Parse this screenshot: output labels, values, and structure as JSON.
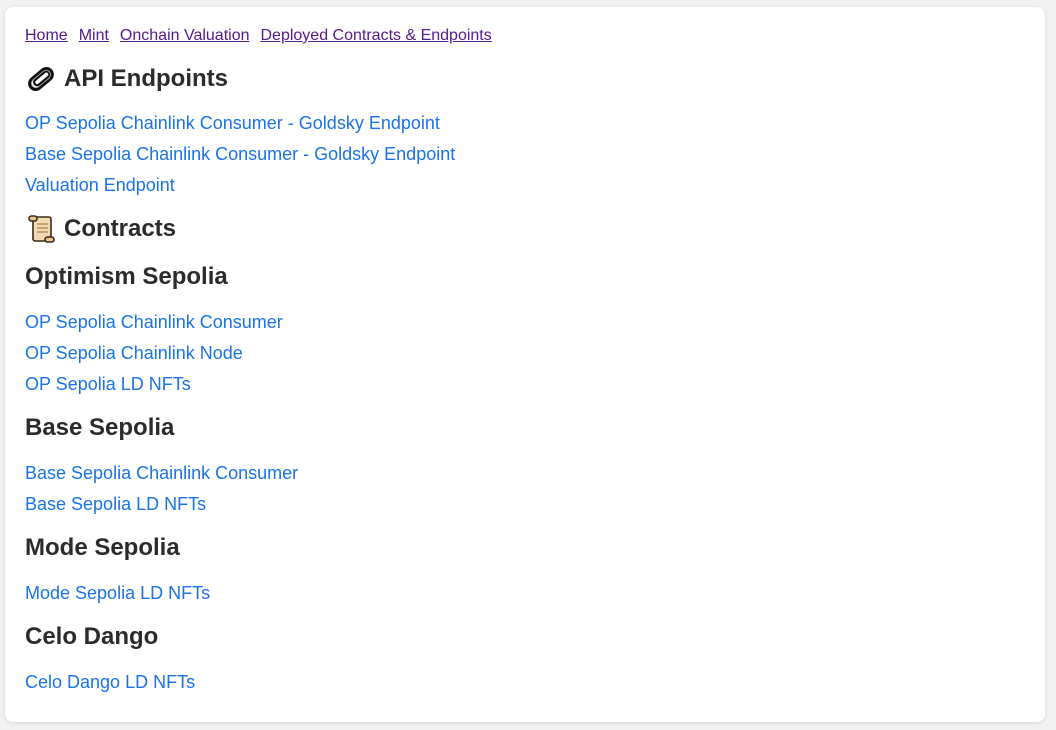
{
  "nav": {
    "items": [
      "Home",
      "Mint",
      "Onchain Valuation",
      "Deployed Contracts & Endpoints"
    ]
  },
  "api": {
    "heading": "API Endpoints",
    "icon": "paperclip-icon",
    "links": [
      "OP Sepolia Chainlink Consumer - Goldsky Endpoint",
      "Base Sepolia Chainlink Consumer - Goldsky Endpoint",
      "Valuation Endpoint"
    ]
  },
  "contracts": {
    "heading": "Contracts",
    "icon": "scroll-icon",
    "sections": [
      {
        "title": "Optimism Sepolia",
        "links": [
          "OP Sepolia Chainlink Consumer",
          "OP Sepolia Chainlink Node",
          "OP Sepolia LD NFTs"
        ]
      },
      {
        "title": "Base Sepolia",
        "links": [
          "Base Sepolia Chainlink Consumer",
          "Base Sepolia LD NFTs"
        ]
      },
      {
        "title": "Mode Sepolia",
        "links": [
          "Mode Sepolia LD NFTs"
        ]
      },
      {
        "title": "Celo Dango",
        "links": [
          "Celo Dango LD NFTs"
        ]
      }
    ]
  },
  "colors": {
    "link": "#1a73e8",
    "visited_nav": "#551a8b",
    "heading": "#2b2b2b"
  }
}
